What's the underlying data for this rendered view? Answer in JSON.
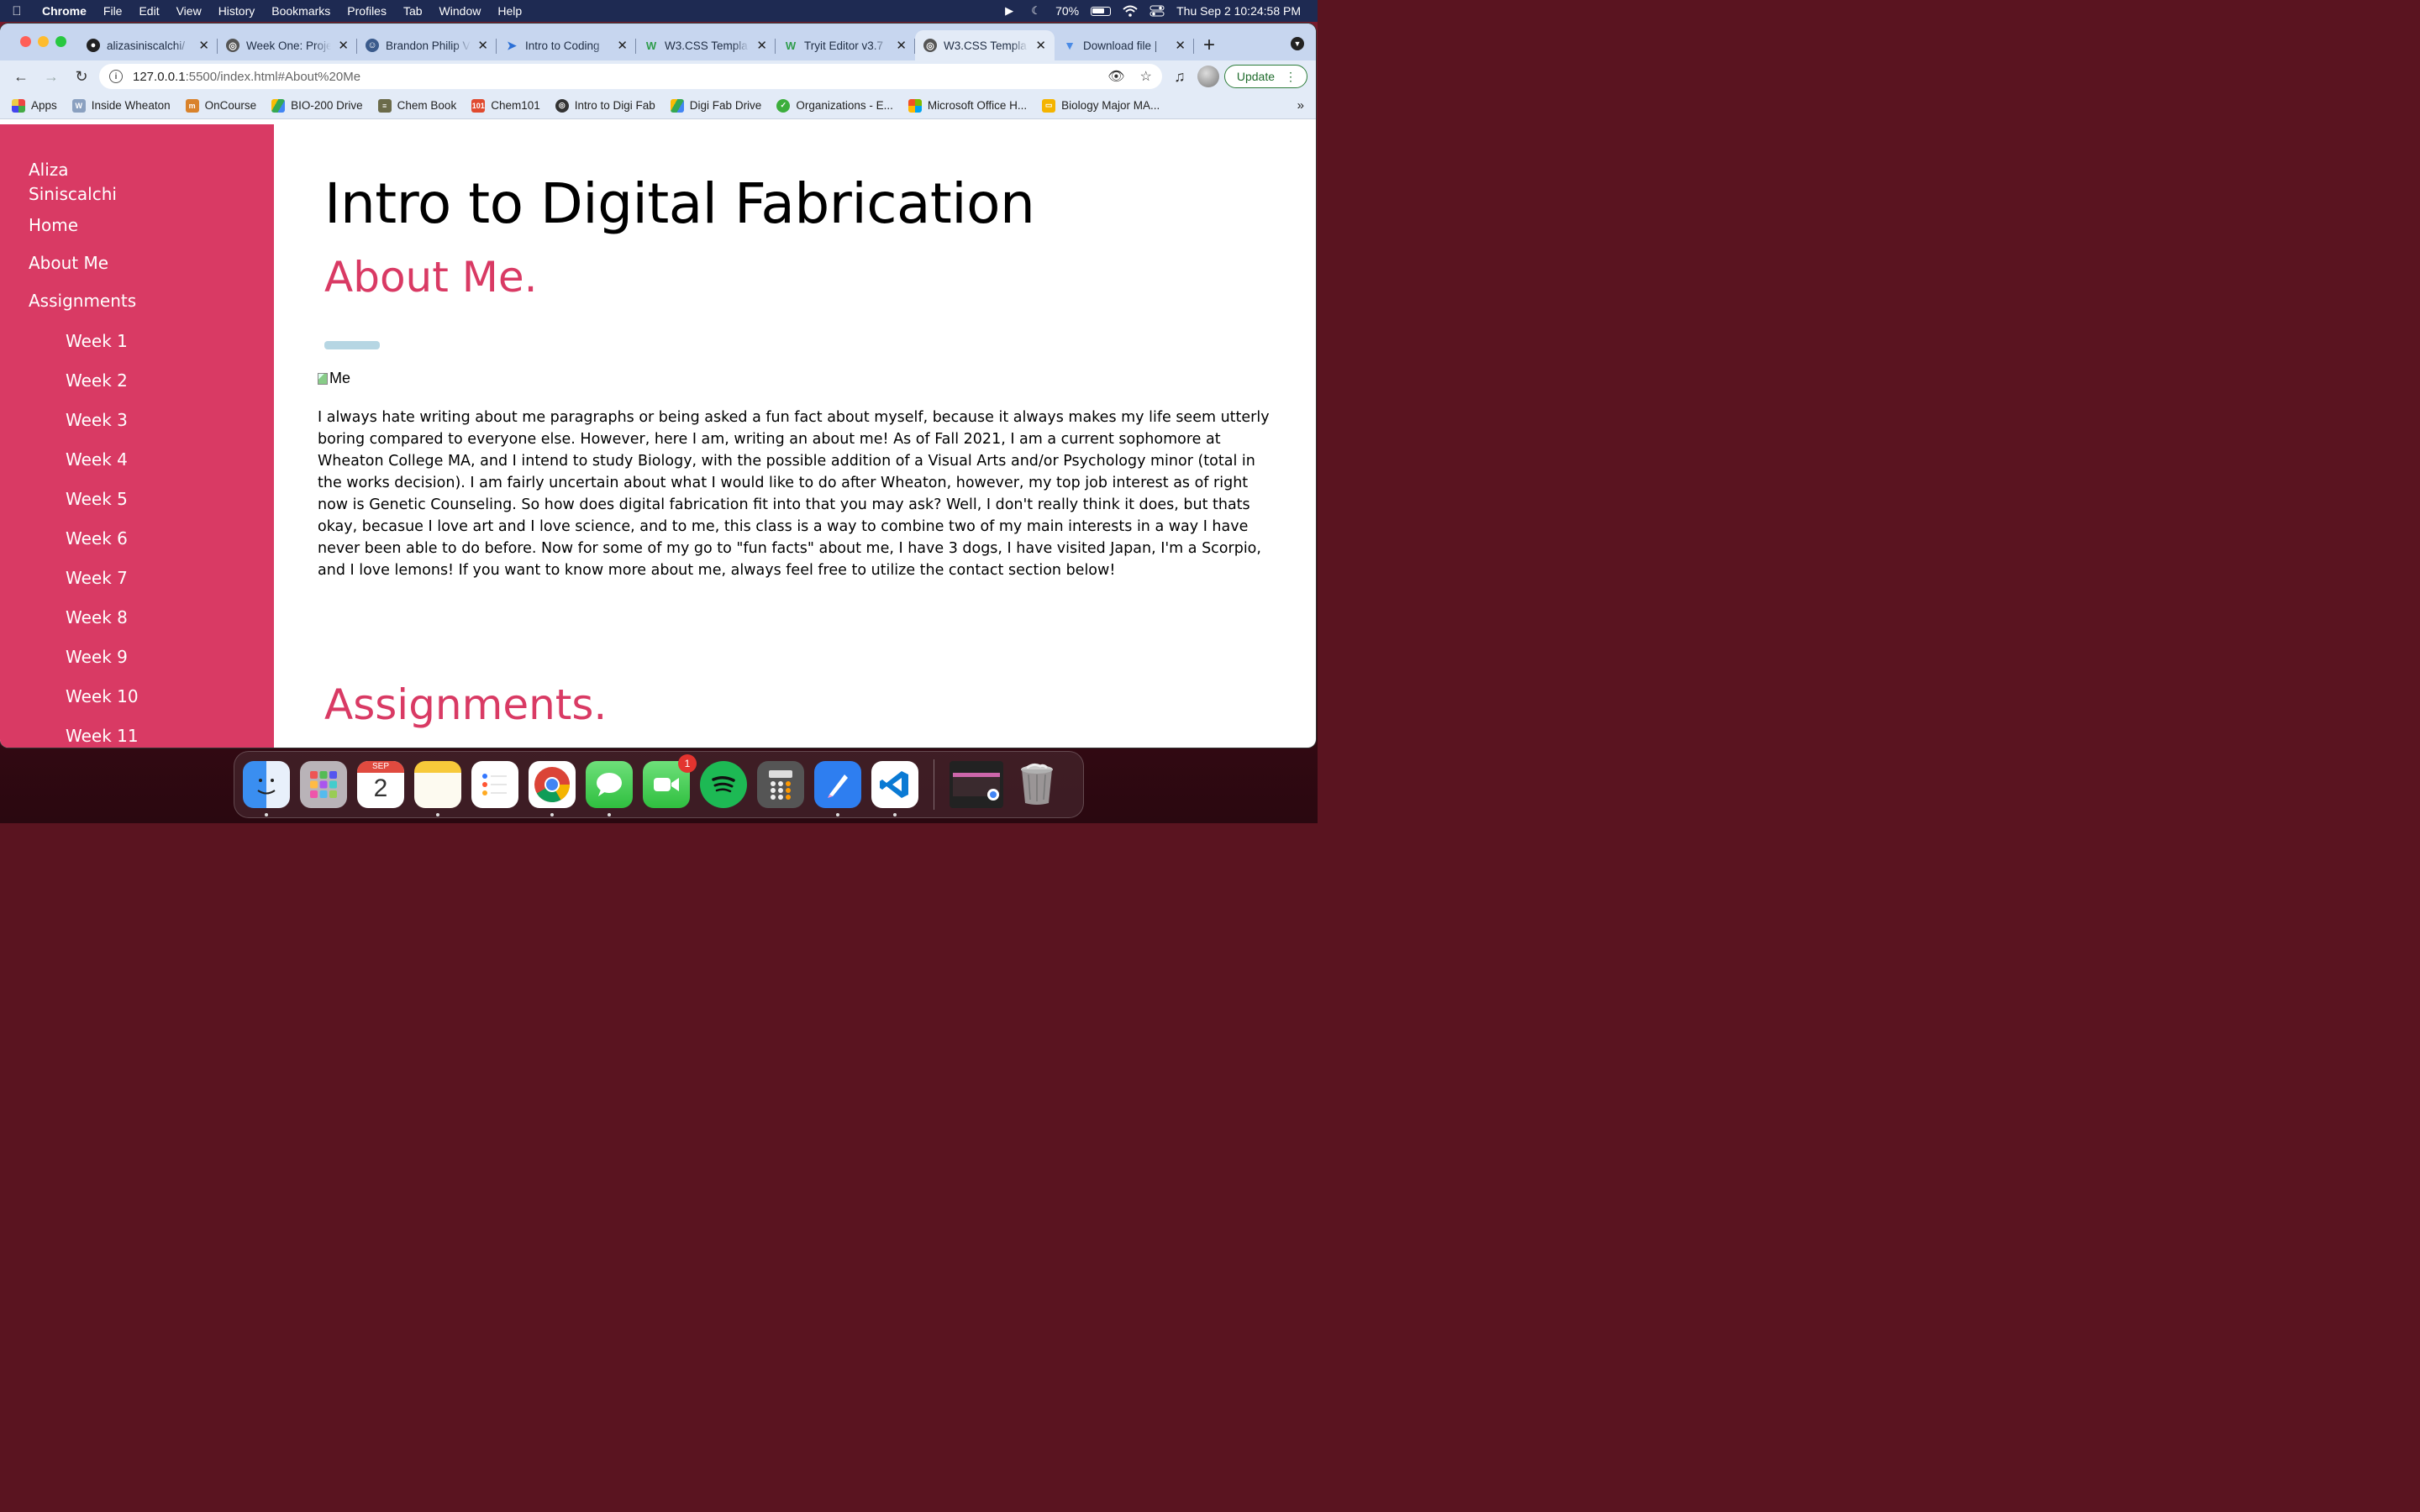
{
  "menubar": {
    "app_name": "Chrome",
    "items": [
      "File",
      "Edit",
      "View",
      "History",
      "Bookmarks",
      "Profiles",
      "Tab",
      "Window",
      "Help"
    ],
    "battery": "70%",
    "datetime": "Thu Sep 2  10:24:58 PM"
  },
  "tabs": [
    {
      "label": "alizasiniscalchi/",
      "icon": "github-icon",
      "color": "#222222"
    },
    {
      "label": "Week One: Proje",
      "icon": "globe-icon",
      "color": "#555555"
    },
    {
      "label": "Brandon Philip V",
      "icon": "profile-icon",
      "color": "#3b5b8c"
    },
    {
      "label": "Intro to Coding",
      "icon": "code-icon",
      "color": "#2b6fd6"
    },
    {
      "label": "W3.CSS Templa",
      "icon": "w3schools-icon",
      "color": "#2e9c4a"
    },
    {
      "label": "Tryit Editor v3.7",
      "icon": "w3schools-icon",
      "color": "#2e9c4a"
    },
    {
      "label": "W3.CSS Templa",
      "icon": "globe-icon",
      "color": "#555555",
      "active": true
    },
    {
      "label": "Download file |",
      "icon": "download-icon",
      "color": "#4a8be6"
    }
  ],
  "address": {
    "host": "127.0.0.1",
    "rest": ":5500/index.html#About%20Me"
  },
  "update_label": "Update",
  "bookmarks": [
    {
      "label": "Apps",
      "icon": "apps-grid-icon",
      "color": "#e44"
    },
    {
      "label": "Inside Wheaton",
      "icon": "wheaton-icon",
      "color": "#8aa0c0"
    },
    {
      "label": "OnCourse",
      "icon": "oncourse-icon",
      "color": "#d9822b"
    },
    {
      "label": "BIO-200 Drive",
      "icon": "drive-icon",
      "color": "#34a853"
    },
    {
      "label": "Chem Book",
      "icon": "book-icon",
      "color": "#6b6b4a"
    },
    {
      "label": "Chem101",
      "icon": "chem101-icon",
      "color": "#e04a2f"
    },
    {
      "label": "Intro to Digi Fab",
      "icon": "globe-icon",
      "color": "#333333"
    },
    {
      "label": "Digi Fab Drive",
      "icon": "drive-icon",
      "color": "#34a853"
    },
    {
      "label": "Organizations - E...",
      "icon": "org-icon",
      "color": "#3cae3c"
    },
    {
      "label": "Microsoft Office H...",
      "icon": "office-icon",
      "color": "#f25022"
    },
    {
      "label": "Biology Major MA...",
      "icon": "slides-icon",
      "color": "#f4b400"
    }
  ],
  "sidebar": {
    "name": "Aliza Siniscalchi",
    "nav": [
      "Home",
      "About Me",
      "Assignments"
    ],
    "weeks": [
      "Week 1",
      "Week 2",
      "Week 3",
      "Week 4",
      "Week 5",
      "Week 6",
      "Week 7",
      "Week 8",
      "Week 9",
      "Week 10",
      "Week 11"
    ]
  },
  "content": {
    "title": "Intro to Digital Fabrication",
    "about_heading": "About Me.",
    "image_alt": "Me",
    "about_text": "I always hate writing about me paragraphs or being asked a fun fact about myself, because it always makes my life seem utterly boring compared to everyone else. However, here I am, writing an about me! As of Fall 2021, I am a current sophomore at Wheaton College MA, and I intend to study Biology, with the possible addition of a Visual Arts and/or Psychology minor (total in the works decision). I am fairly uncertain about what I would like to do after Wheaton, however, my top job interest as of right now is Genetic Counseling. So how does digital fabrication fit into that you may ask? Well, I don't really think it does, but thats okay, becasue I love art and I love science, and to me, this class is a way to combine two of my main interests in a way I have never been able to do before. Now for some of my go to \"fun facts\" about me, I have 3 dogs, I have visited Japan, I'm a Scorpio, and I love lemons! If you want to know more about me, always feel free to utilize the contact section below!",
    "assignments_heading": "Assignments."
  },
  "dock": {
    "calendar_month": "SEP",
    "calendar_day": "2",
    "facetime_badge": "1",
    "apps": [
      "finder-icon",
      "launchpad-icon",
      "calendar-icon",
      "notes-icon",
      "reminders-icon",
      "chrome-icon",
      "messages-icon",
      "facetime-icon",
      "spotify-icon",
      "calculator-icon",
      "pages-icon",
      "vscode-icon"
    ]
  },
  "colors": {
    "sidebar_bg": "#d93a64",
    "heading_accent": "#d93a64",
    "accent_bar": "#b6d6e3"
  }
}
